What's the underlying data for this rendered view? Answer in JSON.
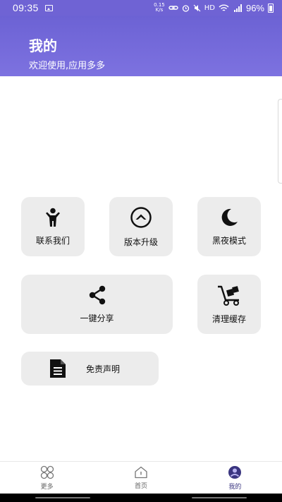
{
  "status_bar": {
    "time": "09:35",
    "speed_value": "0.15",
    "speed_unit": "K/s",
    "network": "HD",
    "battery": "96%"
  },
  "header": {
    "title": "我的",
    "subtitle": "欢迎使用,应用多多"
  },
  "cards": {
    "contact": {
      "label": "联系我们",
      "icon": "person-icon"
    },
    "upgrade": {
      "label": "版本升级",
      "icon": "chevron-up-circle-icon"
    },
    "night": {
      "label": "黑夜模式",
      "icon": "moon-icon"
    },
    "share": {
      "label": "一键分享",
      "icon": "share-icon"
    },
    "cache": {
      "label": "清理缓存",
      "icon": "hand-truck-icon"
    },
    "disclaimer": {
      "label": "免责声明",
      "icon": "document-icon"
    }
  },
  "bottom_nav": {
    "items": [
      {
        "label": "更多",
        "icon": "grid-icon",
        "active": false
      },
      {
        "label": "首页",
        "icon": "home-icon",
        "active": false
      },
      {
        "label": "我的",
        "icon": "user-icon",
        "active": true
      }
    ]
  },
  "colors": {
    "header_gradient_top": "#6c62d4",
    "header_gradient_bottom": "#7d72e0",
    "card_bg": "#ececec",
    "active_nav": "#3a3580"
  }
}
